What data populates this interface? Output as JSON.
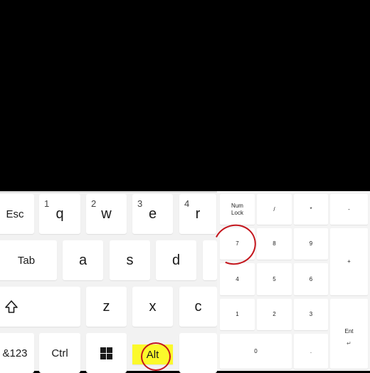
{
  "keyboard": {
    "rows": {
      "r1": [
        {
          "label": "Esc"
        },
        {
          "label": "q",
          "number": "1"
        },
        {
          "label": "w",
          "number": "2"
        },
        {
          "label": "e",
          "number": "3"
        },
        {
          "label": "r",
          "number": "4"
        }
      ],
      "r2": [
        {
          "label": "Tab"
        },
        {
          "label": "a"
        },
        {
          "label": "s"
        },
        {
          "label": "d"
        }
      ],
      "r3": [
        {
          "label": "z"
        },
        {
          "label": "x"
        },
        {
          "label": "c"
        }
      ],
      "r4": [
        {
          "label": "&123"
        },
        {
          "label": "Ctrl"
        },
        {
          "label": "Alt"
        }
      ]
    },
    "highlight_color": "#fbf92b"
  },
  "numpad": {
    "numlock": "Num Lock",
    "slash": "/",
    "asterisk": "*",
    "minus": "-",
    "plus": "+",
    "k7": "7",
    "k8": "8",
    "k9": "9",
    "k4": "4",
    "k5": "5",
    "k6": "6",
    "k1": "1",
    "k2": "2",
    "k3": "3",
    "k0": "0",
    "dot": ".",
    "enter": "Ent"
  },
  "annotation_color": "#c4151c"
}
